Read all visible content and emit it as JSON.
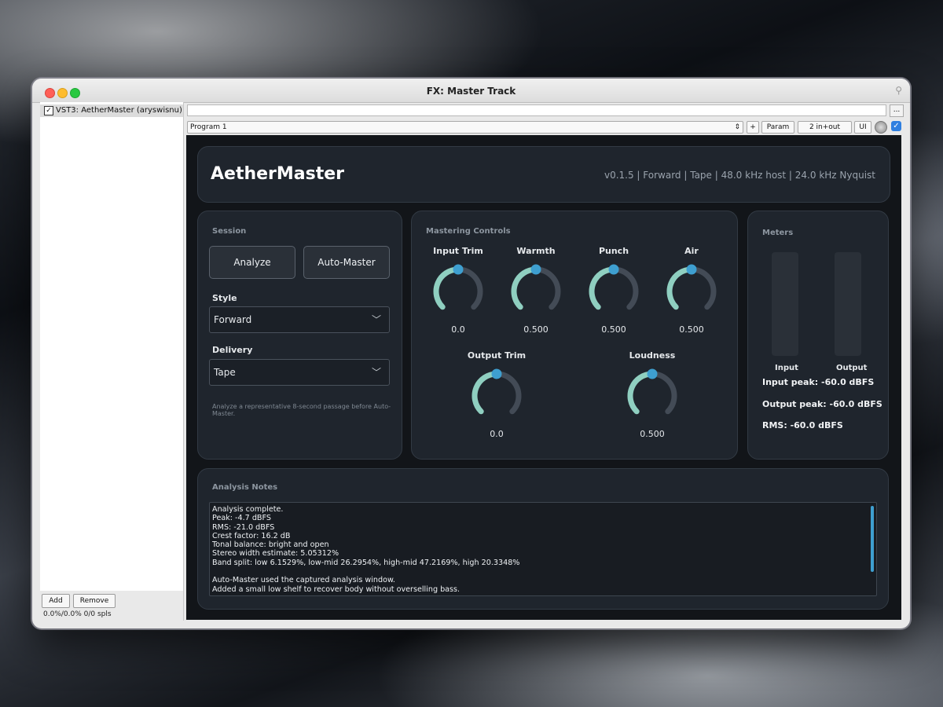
{
  "window": {
    "title": "FX: Master Track"
  },
  "fx_list": {
    "items": [
      {
        "label": "VST3: AetherMaster (aryswisnu)",
        "enabled": true
      }
    ],
    "add_label": "Add",
    "remove_label": "Remove",
    "cpu_text": "0.0%/0.0% 0/0 spls"
  },
  "toolbar": {
    "top_field_value": "",
    "more_label": "...",
    "preset_value": "Program 1",
    "plus_label": "+",
    "param_label": "Param",
    "io_label": "2 in+out",
    "ui_label": "UI"
  },
  "plugin": {
    "title": "AetherMaster",
    "info": "v0.1.5 | Forward | Tape | 48.0 kHz host | 24.0 kHz Nyquist",
    "session": {
      "title": "Session",
      "analyze_label": "Analyze",
      "auto_master_label": "Auto-Master",
      "style_label": "Style",
      "style_value": "Forward",
      "delivery_label": "Delivery",
      "delivery_value": "Tape",
      "hint": "Analyze a representative 8-second passage before Auto-Master."
    },
    "controls": {
      "title": "Mastering Controls",
      "knobs": [
        {
          "label": "Input Trim",
          "value": "0.0",
          "level": 0.5
        },
        {
          "label": "Warmth",
          "value": "0.500",
          "level": 0.5
        },
        {
          "label": "Punch",
          "value": "0.500",
          "level": 0.5
        },
        {
          "label": "Air",
          "value": "0.500",
          "level": 0.5
        },
        {
          "label": "Output Trim",
          "value": "0.0",
          "level": 0.5
        },
        {
          "label": "Loudness",
          "value": "0.500",
          "level": 0.5
        }
      ]
    },
    "meters": {
      "title": "Meters",
      "input_label": "Input",
      "output_label": "Output",
      "input_peak": "Input peak: -60.0 dBFS",
      "output_peak": "Output peak: -60.0 dBFS",
      "rms": "RMS: -60.0 dBFS"
    },
    "notes": {
      "title": "Analysis Notes",
      "text": "Analysis complete.\nPeak: -4.7 dBFS\nRMS: -21.0 dBFS\nCrest factor: 16.2 dB\nTonal balance: bright and open\nStereo width estimate: 5.05312%\nBand split: low 6.1529%, low-mid 26.2954%, high-mid 47.2169%, high 20.3348%\n\nAuto-Master used the captured analysis window.\nAdded a small low shelf to recover body without overselling bass."
    }
  },
  "colors": {
    "accent": "#3e9fd0",
    "knob_arc": "#8fcfc0",
    "knob_track": "#434b56",
    "panel": "#1f252d"
  }
}
